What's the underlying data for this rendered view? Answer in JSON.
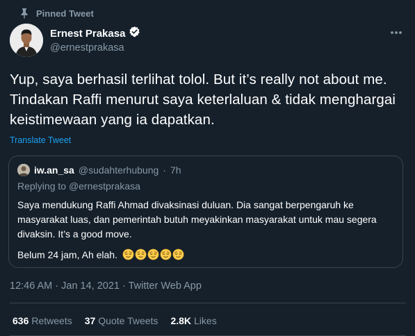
{
  "pinned": {
    "label": "Pinned Tweet",
    "icon": "pin-icon"
  },
  "author": {
    "name": "Ernest Prakasa",
    "handle": "@ernestprakasa",
    "verified": true
  },
  "tweet": {
    "text": "Yup, saya berhasil terlihat tolol. But it’s really not about me. Tindakan Raffi menurut saya keterlaluan & tidak menghargai keistimewaan yang ia dapatkan.",
    "translate_label": "Translate Tweet"
  },
  "quote": {
    "name": "iw.an_sa",
    "handle": "@sudahterhubung",
    "dot": "·",
    "time": "7h",
    "replying_prefix": "Replying to ",
    "replying_to": "@ernestprakasa",
    "body": "Saya mendukung Raffi Ahmad divaksinasi duluan. Dia sangat berpengaruh ke masyarakat luas, dan pemerintah butuh meyakinkan masyarakat untuk mau segera divaksin. It’s a good move.",
    "body2": "Belum 24 jam, Ah elah.",
    "emoji_name": "relieved-face-emoji",
    "emoji_count": 5
  },
  "meta": {
    "text": "12:46 AM · Jan 14, 2021 · Twitter Web App"
  },
  "stats": {
    "retweets_value": "636",
    "retweets_label": "Retweets",
    "quotes_value": "37",
    "quotes_label": "Quote Tweets",
    "likes_value": "2.8K",
    "likes_label": "Likes"
  },
  "colors": {
    "background": "#15202b",
    "secondary_text": "#8899a6",
    "link": "#1da1f2",
    "border": "#38444d",
    "verified_badge": "#ffffff"
  }
}
